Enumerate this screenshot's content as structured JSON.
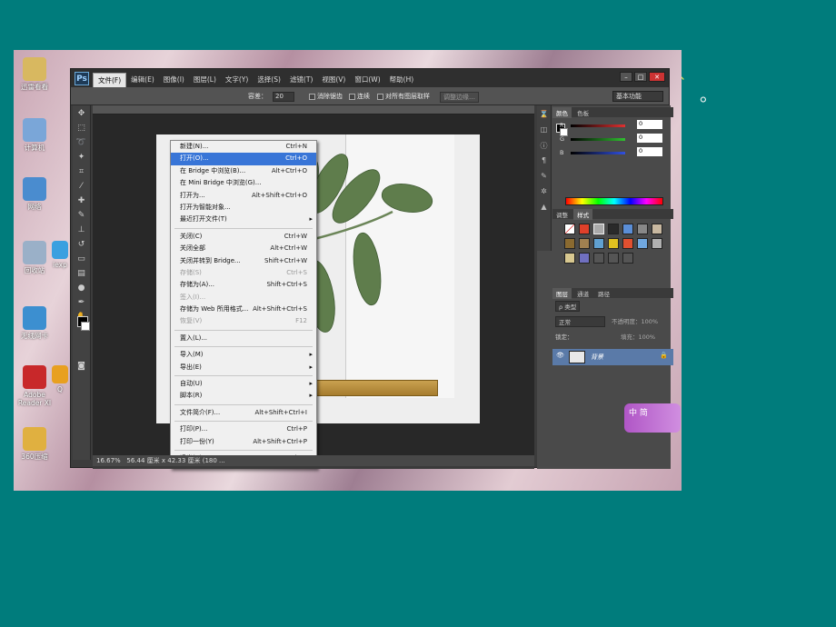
{
  "slide": {
    "mark": "。",
    "accent": "、"
  },
  "desktop_icons": [
    {
      "label": "迅雷看看",
      "color": "#d8b860"
    },
    {
      "label": "计算机",
      "color": "#7aa6d8"
    },
    {
      "label": "网络",
      "color": "#4a8ccf"
    },
    {
      "label": "回收站",
      "color": "#9ab0c8"
    },
    {
      "label": "无线网卡",
      "color": "#3c8fd0"
    },
    {
      "label": "Adobe Reader XI",
      "color": "#c8282a"
    },
    {
      "label": "360压缩",
      "color": "#e0b040"
    }
  ],
  "desktop_icons_col2": [
    {
      "label": "iexp",
      "color": "#3aa0e0"
    },
    {
      "label": "Q",
      "color": "#e8a020"
    }
  ],
  "ps": {
    "logo": "Ps",
    "menus": [
      "文件(F)",
      "编辑(E)",
      "图像(I)",
      "图层(L)",
      "文字(Y)",
      "选择(S)",
      "滤镜(T)",
      "视图(V)",
      "窗口(W)",
      "帮助(H)"
    ],
    "window_controls": [
      "–",
      "□",
      "✕"
    ],
    "options": {
      "tolerance_label": "容差：",
      "tolerance_value": "20",
      "antialias": "消除锯齿",
      "contiguous": "连续",
      "sample_all": "对所有图层取样",
      "refine": "调整边缘…",
      "workspace": "基本功能"
    },
    "file_menu": [
      {
        "label": "新建(N)...",
        "shortcut": "Ctrl+N"
      },
      {
        "label": "打开(O)...",
        "shortcut": "Ctrl+O",
        "selected": true
      },
      {
        "label": "在 Bridge 中浏览(B)...",
        "shortcut": "Alt+Ctrl+O"
      },
      {
        "label": "在 Mini Bridge 中浏览(G)...",
        "shortcut": ""
      },
      {
        "label": "打开为...",
        "shortcut": "Alt+Shift+Ctrl+O"
      },
      {
        "label": "打开为智能对象...",
        "shortcut": ""
      },
      {
        "label": "最近打开文件(T)",
        "shortcut": "",
        "submenu": true
      },
      {
        "sep": true
      },
      {
        "label": "关闭(C)",
        "shortcut": "Ctrl+W"
      },
      {
        "label": "关闭全部",
        "shortcut": "Alt+Ctrl+W"
      },
      {
        "label": "关闭并转到 Bridge...",
        "shortcut": "Shift+Ctrl+W"
      },
      {
        "label": "存储(S)",
        "shortcut": "Ctrl+S",
        "disabled": true
      },
      {
        "label": "存储为(A)...",
        "shortcut": "Shift+Ctrl+S"
      },
      {
        "label": "签入(I)...",
        "shortcut": "",
        "disabled": true
      },
      {
        "label": "存储为 Web 所用格式...",
        "shortcut": "Alt+Shift+Ctrl+S"
      },
      {
        "label": "恢复(V)",
        "shortcut": "F12",
        "disabled": true
      },
      {
        "sep": true
      },
      {
        "label": "置入(L)...",
        "shortcut": ""
      },
      {
        "sep": true
      },
      {
        "label": "导入(M)",
        "shortcut": "",
        "submenu": true
      },
      {
        "label": "导出(E)",
        "shortcut": "",
        "submenu": true
      },
      {
        "sep": true
      },
      {
        "label": "自动(U)",
        "shortcut": "",
        "submenu": true
      },
      {
        "label": "脚本(R)",
        "shortcut": "",
        "submenu": true
      },
      {
        "sep": true
      },
      {
        "label": "文件简介(F)...",
        "shortcut": "Alt+Shift+Ctrl+I"
      },
      {
        "sep": true
      },
      {
        "label": "打印(P)...",
        "shortcut": "Ctrl+P"
      },
      {
        "label": "打印一份(Y)",
        "shortcut": "Alt+Shift+Ctrl+P"
      },
      {
        "sep": true
      },
      {
        "label": "退出(X)",
        "shortcut": "Ctrl+Q"
      }
    ],
    "status": {
      "zoom": "16.67%",
      "doc_size": "56.44 厘米 x 42.33 厘米 (180 ..."
    },
    "timeline_label": "时间轴",
    "color_panel": {
      "tabs": [
        "颜色",
        "色板"
      ],
      "channels": [
        {
          "label": "R",
          "value": "0",
          "color": "#e03030"
        },
        {
          "label": "G",
          "value": "0",
          "color": "#30c030"
        },
        {
          "label": "B",
          "value": "0",
          "color": "#3050e0"
        }
      ]
    },
    "adjust_panel": {
      "tabs": [
        "调整",
        "样式"
      ]
    },
    "layers_panel": {
      "tabs": [
        "图层",
        "通道",
        "路径"
      ],
      "kind": "ρ 类型",
      "blend": "正常",
      "opacity_label": "不透明度：",
      "opacity": "100%",
      "lock_label": "锁定：",
      "fill_label": "填充：",
      "fill": "100%",
      "layer_name": "背景"
    },
    "badge": "中 简"
  },
  "desk_under": [
    "6.0",
    "doc"
  ]
}
